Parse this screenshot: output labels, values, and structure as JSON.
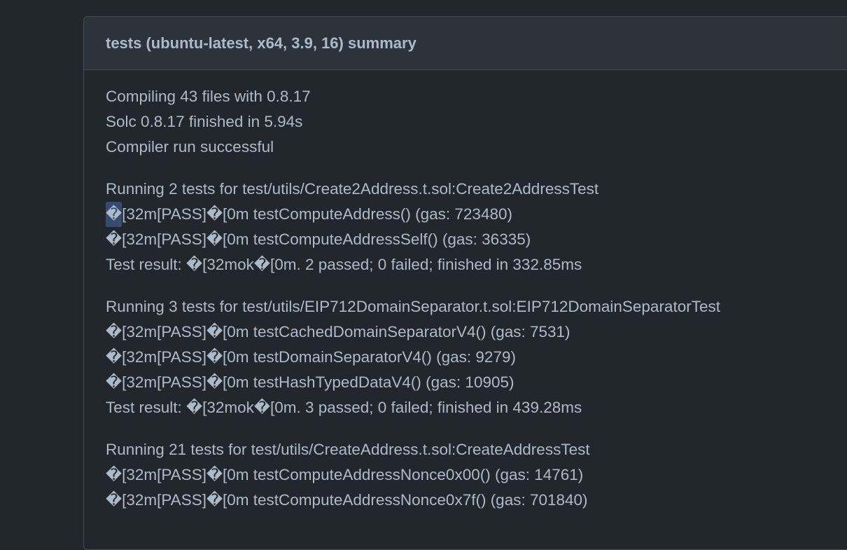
{
  "summary": {
    "title": "tests (ubuntu-latest, x64, 3.9, 16) summary"
  },
  "colors": {
    "background": "#22272e",
    "header_background": "#2d333b",
    "border": "#444c56",
    "text": "#adbac7",
    "selection_highlight": "#354b70"
  },
  "blocks": [
    {
      "lines": [
        "Compiling 43 files with 0.8.17",
        "Solc 0.8.17 finished in 5.94s",
        "Compiler run successful"
      ]
    },
    {
      "lines": [
        "Running 2 tests for test/utils/Create2Address.t.sol:Create2AddressTest",
        "[32m[PASS]�[0m testComputeAddress() (gas: 723480)",
        "�[32m[PASS]�[0m testComputeAddressSelf() (gas: 36335)",
        "Test result: �[32mok�[0m. 2 passed; 0 failed; finished in 332.85ms"
      ],
      "highlight_glyph": "�"
    },
    {
      "lines": [
        "Running 3 tests for test/utils/EIP712DomainSeparator.t.sol:EIP712DomainSeparatorTest",
        "�[32m[PASS]�[0m testCachedDomainSeparatorV4() (gas: 7531)",
        "�[32m[PASS]�[0m testDomainSeparatorV4() (gas: 9279)",
        "�[32m[PASS]�[0m testHashTypedDataV4() (gas: 10905)",
        "Test result: �[32mok�[0m. 3 passed; 0 failed; finished in 439.28ms"
      ]
    },
    {
      "lines": [
        "Running 21 tests for test/utils/CreateAddress.t.sol:CreateAddressTest",
        "�[32m[PASS]�[0m testComputeAddressNonce0x00() (gas: 14761)",
        "�[32m[PASS]�[0m testComputeAddressNonce0x7f() (gas: 701840)"
      ]
    }
  ]
}
